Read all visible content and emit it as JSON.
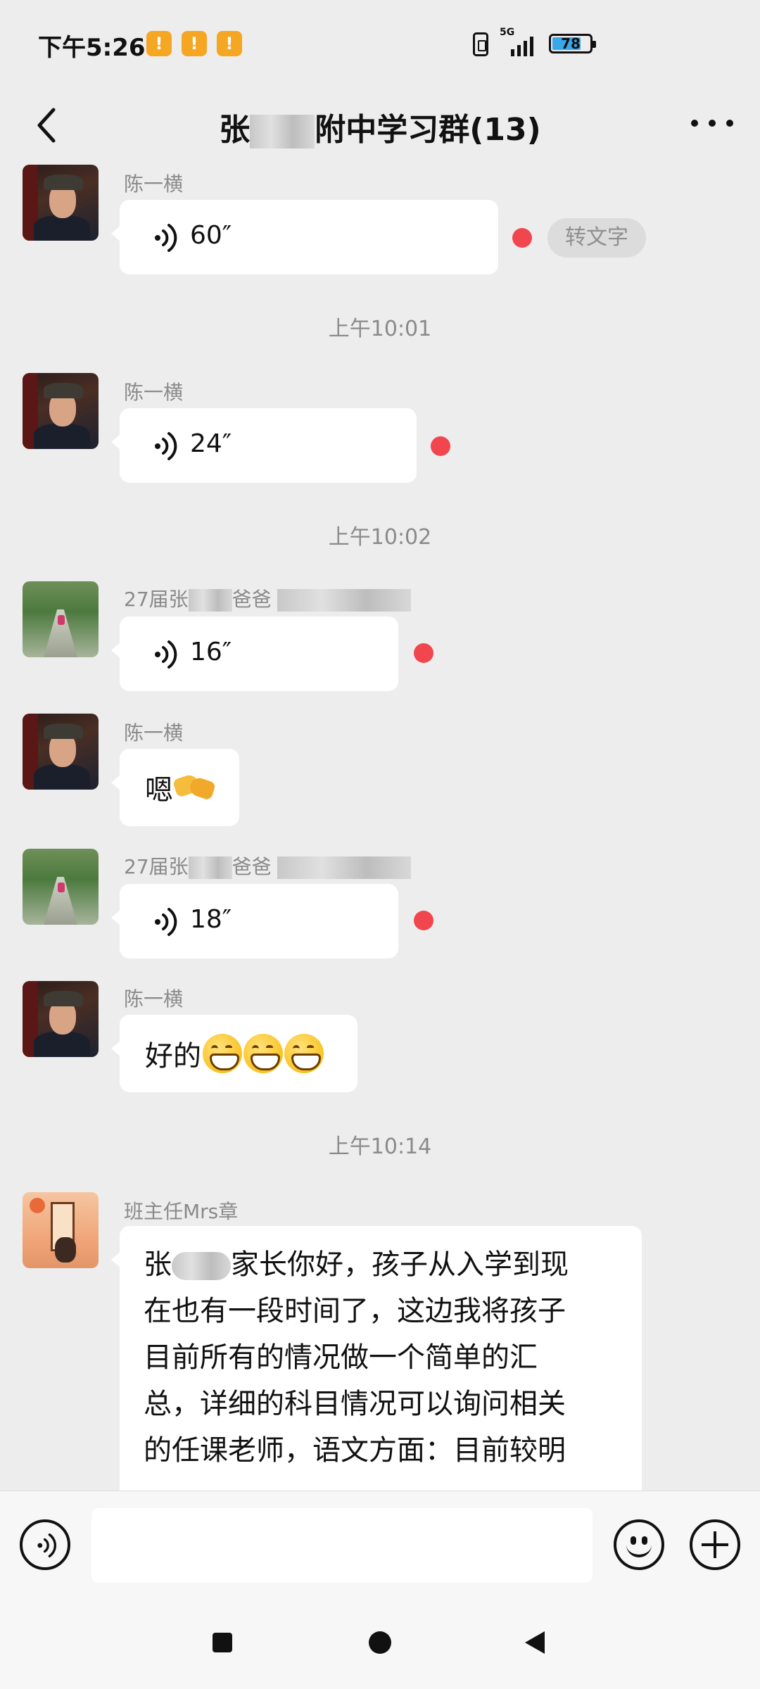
{
  "status_bar": {
    "time": "下午5:26",
    "network": "5G",
    "battery": "78"
  },
  "header": {
    "title_before": "张",
    "title_after": "附中学习群(13)"
  },
  "messages": {
    "m1": {
      "sender": "陈一横",
      "duration": "60″",
      "to_text": "转文字"
    },
    "t1": "上午10:01",
    "m2": {
      "sender": "陈一横",
      "duration": "24″"
    },
    "t2": "上午10:02",
    "m3": {
      "sender_a": "27届张",
      "sender_b": "爸爸",
      "duration": "16″"
    },
    "m4": {
      "sender": "陈一横",
      "text": "嗯"
    },
    "m5": {
      "sender_a": "27届张",
      "sender_b": "爸爸",
      "duration": "18″"
    },
    "m6": {
      "sender": "陈一横",
      "text": "好的"
    },
    "t3": "上午10:14",
    "m7": {
      "sender": "班主任Mrs章",
      "text_a": "张",
      "text_b": "家长你好，孩子从入学到现\n在也有一段时间了，这边我将孩子\n目前所有的情况做一个简单的汇\n总，详细的科目情况可以询问相关\n的任课老师，语文方面：目前较明"
    }
  },
  "colors": {
    "unread": "#f2464f",
    "background": "#ededed",
    "bubble": "#ffffff"
  },
  "icons": [
    "back-icon",
    "more-icon",
    "voice-icon",
    "emoji-icon",
    "plus-icon"
  ]
}
